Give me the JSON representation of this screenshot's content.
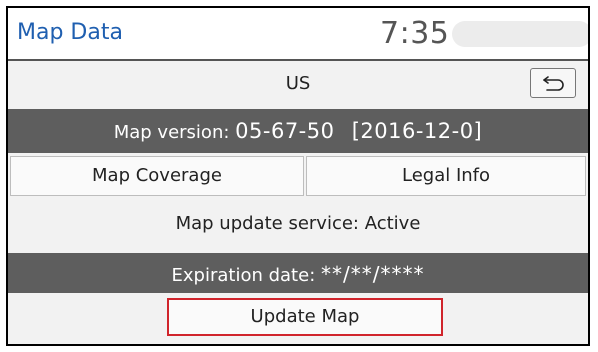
{
  "header": {
    "title": "Map Data",
    "clock": "7:35"
  },
  "region": {
    "label": "US",
    "back_icon": "back-arrow-icon"
  },
  "version": {
    "label": "Map version:",
    "value": "05-67-50",
    "date": "[2016-12-0]"
  },
  "buttons": {
    "coverage": "Map Coverage",
    "legal": "Legal Info"
  },
  "service": {
    "status": "Map update service: Active"
  },
  "expiration": {
    "label": "Expiration date:",
    "value": "**/**/****"
  },
  "update": {
    "label": "Update Map"
  },
  "colors": {
    "title": "#1f5fb0",
    "dark_bar": "#5e5e5e",
    "highlight_border": "#d0242b",
    "background": "#f2f2f2"
  }
}
